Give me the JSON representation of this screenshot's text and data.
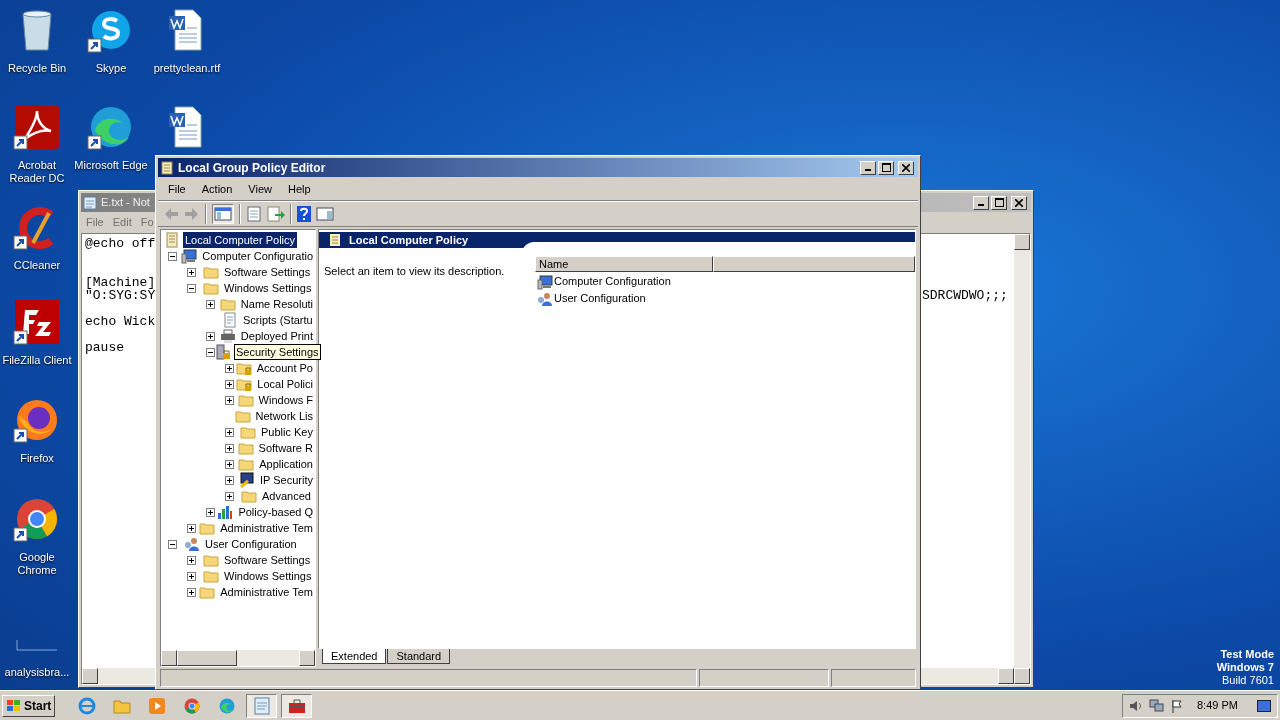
{
  "desktop_icons": [
    {
      "kind": "recycle-bin",
      "label": "Recycle Bin",
      "shortcut": false
    },
    {
      "kind": "chat",
      "label": "Skype",
      "shortcut": true
    },
    {
      "kind": "document",
      "label": "prettyclean.rtf",
      "shortcut": false
    },
    {
      "kind": "pdf",
      "label": "Acrobat Reader DC",
      "shortcut": true
    },
    {
      "kind": "edge",
      "label": "Microsoft Edge",
      "shortcut": true
    },
    {
      "kind": "document",
      "shortcut": false
    },
    {
      "kind": "broom",
      "label": "CCleaner",
      "shortcut": true
    },
    {
      "kind": "ftp",
      "label": "FileZilla Client",
      "shortcut": true
    },
    {
      "kind": "firefox",
      "label": "Firefox",
      "shortcut": true
    },
    {
      "kind": "chrome",
      "label": "Google Chrome",
      "shortcut": true
    },
    {
      "kind": "blank",
      "label": "analysisbra...",
      "shortcut": false
    }
  ],
  "desktop_text": [
    {
      "text": "Test Mode",
      "bold": true
    },
    {
      "text": "Windows 7",
      "bold": true
    },
    {
      "text": "Build 7601",
      "bold": false
    }
  ],
  "notepad": {
    "title": "E.txt - Not",
    "active": false,
    "menu": [
      "File",
      "Edit",
      "Fo"
    ],
    "paragraphs": [
      [
        "@echo off"
      ],
      [
        "[Machine]",
        "\"O:SYG:SY"
      ],
      [
        "echo Wick"
      ],
      [
        "pause"
      ]
    ],
    "right_text": "SDRCWDWO;;;"
  },
  "gpe": {
    "title": "Local Group Policy Editor",
    "active": true,
    "menu": [
      "File",
      "Action",
      "View",
      "Help"
    ],
    "toolbar": [
      {
        "kind": "back",
        "disabled": true
      },
      {
        "kind": "forward",
        "disabled": true
      },
      {
        "kind": "tree",
        "disabled": false
      },
      {
        "kind": "properties",
        "disabled": false
      },
      {
        "kind": "export",
        "disabled": false
      },
      {
        "kind": "help",
        "disabled": false
      },
      {
        "kind": "pane",
        "disabled": false
      }
    ],
    "tree": [
      {
        "label": "Local Computer Policy",
        "kind": "policy",
        "selected": true,
        "hovered": false,
        "children": [
          {
            "label": "Computer Configuratio",
            "kind": "computer",
            "selected": false,
            "hovered": false,
            "expander": true,
            "expanded": true,
            "children": [
              {
                "label": "Software Settings",
                "kind": "folder",
                "selected": false,
                "hovered": false,
                "expander": true,
                "expanded": false
              },
              {
                "label": "Windows Settings",
                "kind": "folder",
                "selected": false,
                "hovered": false,
                "expander": true,
                "expanded": true,
                "children": [
                  {
                    "label": "Name Resoluti",
                    "kind": "folder",
                    "selected": false,
                    "hovered": false,
                    "expander": true,
                    "expanded": false
                  },
                  {
                    "label": "Scripts (Startu",
                    "kind": "script",
                    "selected": false,
                    "hovered": false,
                    "expander": false,
                    "expanded": false
                  },
                  {
                    "label": "Deployed Print",
                    "kind": "printer",
                    "selected": false,
                    "hovered": false,
                    "expander": true,
                    "expanded": false
                  },
                  {
                    "label": "Security Settings",
                    "kind": "security",
                    "selected": false,
                    "hovered": true,
                    "expander": true,
                    "expanded": true,
                    "children": [
                      {
                        "label": "Account Po",
                        "kind": "folder-lock",
                        "selected": false,
                        "hovered": false,
                        "expander": true,
                        "expanded": false
                      },
                      {
                        "label": "Local Polici",
                        "kind": "folder-lock",
                        "selected": false,
                        "hovered": false,
                        "expander": true,
                        "expanded": false
                      },
                      {
                        "label": "Windows F",
                        "kind": "folder",
                        "selected": false,
                        "hovered": false,
                        "expander": true,
                        "expanded": false
                      },
                      {
                        "label": "Network Lis",
                        "kind": "folder",
                        "selected": false,
                        "hovered": false,
                        "expander": false,
                        "expanded": false
                      },
                      {
                        "label": "Public Key",
                        "kind": "folder",
                        "selected": false,
                        "hovered": false,
                        "expander": true,
                        "expanded": false
                      },
                      {
                        "label": "Software R",
                        "kind": "folder",
                        "selected": false,
                        "hovered": false,
                        "expander": true,
                        "expanded": false
                      },
                      {
                        "label": "Application",
                        "kind": "folder",
                        "selected": false,
                        "hovered": false,
                        "expander": true,
                        "expanded": false
                      },
                      {
                        "label": "IP Security",
                        "kind": "ip-security",
                        "selected": false,
                        "hovered": false,
                        "expander": true,
                        "expanded": false
                      },
                      {
                        "label": "Advanced",
                        "kind": "folder",
                        "selected": false,
                        "hovered": false,
                        "expander": true,
                        "expanded": false
                      }
                    ]
                  },
                  {
                    "label": "Policy-based Q",
                    "kind": "chart",
                    "selected": false,
                    "hovered": false,
                    "expander": true,
                    "expanded": false
                  }
                ]
              },
              {
                "label": "Administrative Tem",
                "kind": "folder",
                "selected": false,
                "hovered": false,
                "expander": true,
                "expanded": false
              }
            ]
          },
          {
            "label": "User Configuration",
            "kind": "user",
            "selected": false,
            "hovered": false,
            "expander": true,
            "expanded": true,
            "children": [
              {
                "label": "Software Settings",
                "kind": "folder",
                "selected": false,
                "hovered": false,
                "expander": true,
                "expanded": false
              },
              {
                "label": "Windows Settings",
                "kind": "folder",
                "selected": false,
                "hovered": false,
                "expander": true,
                "expanded": false
              },
              {
                "label": "Administrative Tem",
                "kind": "folder",
                "selected": false,
                "hovered": false,
                "expander": true,
                "expanded": false
              }
            ]
          }
        ]
      }
    ],
    "detail": {
      "header": "Local Computer Policy",
      "description": "Select an item to view its description.",
      "columns": [
        "Name"
      ],
      "items": [
        {
          "kind": "computer",
          "label": "Computer Configuration"
        },
        {
          "kind": "user",
          "label": "User Configuration"
        }
      ]
    },
    "view_tabs": [
      {
        "label": "Extended",
        "selected": true
      },
      {
        "label": "Standard",
        "selected": false
      }
    ]
  },
  "taskbar": {
    "start": "Start",
    "apps": [
      {
        "kind": "ie",
        "active": false
      },
      {
        "kind": "explorer",
        "active": false
      },
      {
        "kind": "media",
        "active": false
      },
      {
        "kind": "chrome",
        "active": false
      },
      {
        "kind": "edge",
        "active": false
      },
      {
        "kind": "notepad",
        "active": true
      },
      {
        "kind": "gpe",
        "active": true
      }
    ],
    "clock": "8:49 PM"
  }
}
